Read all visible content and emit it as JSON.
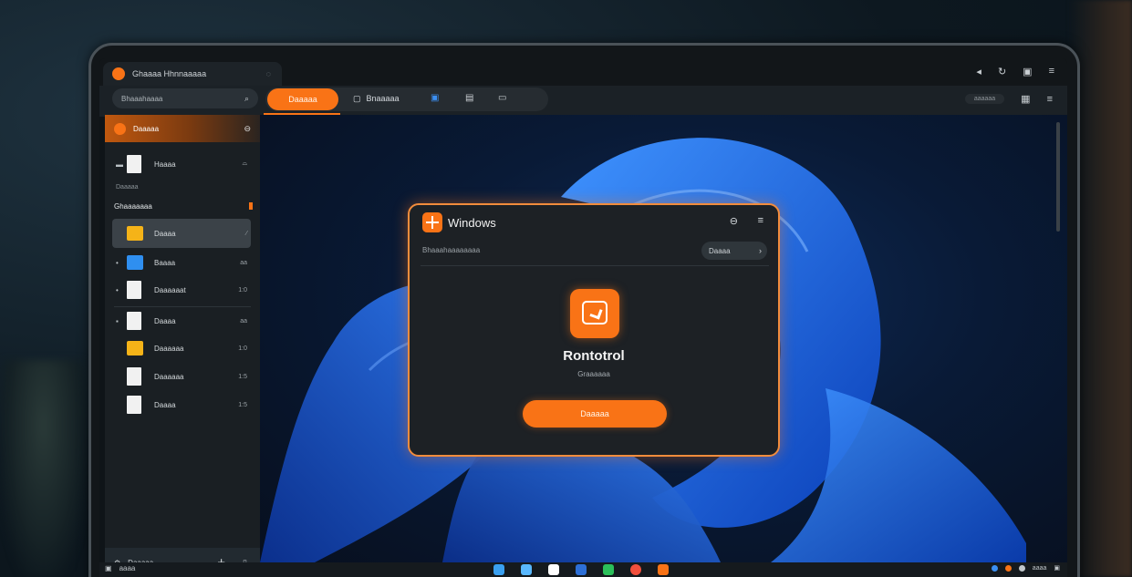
{
  "titlebar": {
    "tab_title": "Ghaaaa Hhnnaaaaa",
    "tab_close_icon": "◌",
    "icons": [
      "◂",
      "↻",
      "▣",
      "≡"
    ]
  },
  "toolbar": {
    "search_placeholder": "Bhaaahaaaa",
    "active_tab": "Daaaaa",
    "tab2_label": "Bnaaaaa",
    "pill": "aaaaaa"
  },
  "sidebar": {
    "selected": "Daaaaa",
    "item_home": "Haaaa",
    "sub_label": "Daaaaa",
    "section_head": "Ghaaaaaaa",
    "rows": [
      {
        "label": "Daaaa",
        "meta": "",
        "kind": "folder-yellow"
      },
      {
        "label": "Baaaa",
        "meta": "aa",
        "kind": "folder-blue"
      },
      {
        "label": "Daaaaaat",
        "meta": "1:0",
        "kind": "doc"
      },
      {
        "label": "Daaaa",
        "meta": "aa",
        "kind": "doc"
      },
      {
        "label": "Daaaaaa",
        "meta": "1:0",
        "kind": "folder-yellow"
      },
      {
        "label": "Daaaaaa",
        "meta": "1:5",
        "kind": "doc"
      },
      {
        "label": "Daaaa",
        "meta": "1:5",
        "kind": "doc"
      }
    ],
    "footer_label": "Daaaaa"
  },
  "dialog": {
    "title": "Windows",
    "subtitle": "Bhaaahaaaaaaaa",
    "select_value": "Daaaa",
    "app_name": "Rontotrol",
    "caption": "Graaaaaa",
    "button": "Daaaaa"
  },
  "taskbar": {
    "left_text": "aaaa",
    "right_text": "aaaa"
  },
  "colors": {
    "accent": "#f97316",
    "wallpaper_blue": "#2f7bf0",
    "surface": "#1d2125"
  }
}
